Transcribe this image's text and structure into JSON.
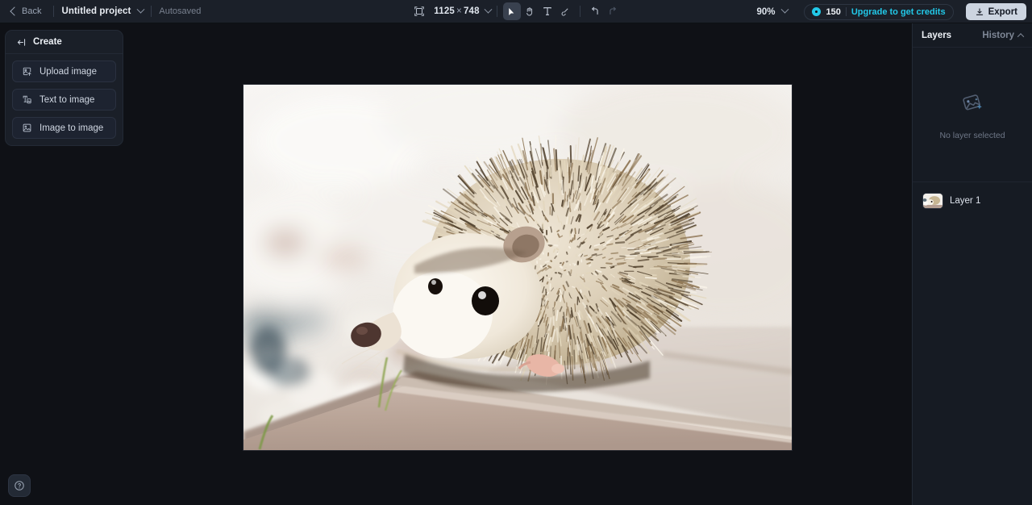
{
  "topbar": {
    "back_label": "Back",
    "project_name": "Untitled project",
    "autosaved_label": "Autosaved",
    "dimensions": {
      "width": "1125",
      "separator": "×",
      "height": "748"
    },
    "tools": [
      {
        "name": "resize-tool",
        "label": "Resize",
        "active": false
      },
      {
        "name": "select-tool",
        "label": "Select",
        "active": true
      },
      {
        "name": "hand-tool",
        "label": "Pan",
        "active": false
      },
      {
        "name": "text-tool",
        "label": "T",
        "active": false
      },
      {
        "name": "brush-tool",
        "label": "Brush",
        "active": false
      },
      {
        "name": "undo",
        "label": "Undo",
        "active": false
      },
      {
        "name": "redo",
        "label": "Redo",
        "active": false
      }
    ],
    "zoom_level": "90%",
    "credits_count": "150",
    "upgrade_label": "Upgrade to get credits",
    "export_label": "Export"
  },
  "create_panel": {
    "title": "Create",
    "items": [
      {
        "label": "Upload image",
        "icon": "upload-image-icon"
      },
      {
        "label": "Text to image",
        "icon": "text-to-image-icon"
      },
      {
        "label": "Image to image",
        "icon": "image-to-image-icon"
      }
    ]
  },
  "right_panel": {
    "tab_layers": "Layers",
    "tab_history": "History",
    "empty_state_label": "No layer selected",
    "layers": [
      {
        "name": "Layer 1"
      }
    ]
  },
  "help": {
    "label": "Help"
  },
  "colors": {
    "accent_cyan": "#22c8e8",
    "panel_bg": "#1a1f28",
    "topbar_bg": "#1b2029",
    "canvas_bg": "#0f1116",
    "export_btn_bg": "#ccd4e0"
  }
}
